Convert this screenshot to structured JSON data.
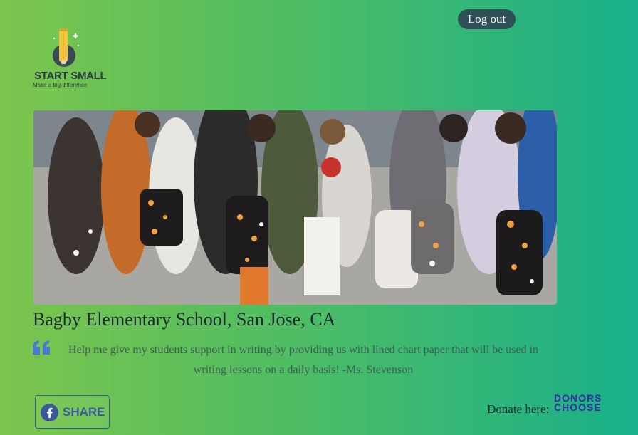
{
  "header": {
    "logout_label": "Log out"
  },
  "logo": {
    "title": "START SMALL",
    "tagline": "Make a big difference",
    "icon": "pencil-rocket-icon",
    "colors": {
      "pencil": "#f2c53d",
      "tip": "#2d3a44",
      "body": "#2d3a44"
    }
  },
  "project": {
    "photo_icon": "school-event-photo",
    "school": "Bagby Elementary School, San Jose, CA",
    "quote_icon": "quote-icon",
    "quote": "Help me give my students support in writing by providing us with lined chart paper that will be used in writing lessons on a daily basis! -Ms. Stevenson"
  },
  "footer": {
    "share_icon": "facebook-icon",
    "share_label": "SHARE",
    "donate_label": "Donate here:",
    "donors_line1": "DONORS",
    "donors_line2": "CHOOSE"
  },
  "colors": {
    "gradient_start": "#7cc54c",
    "gradient_end": "#19b08a",
    "logout_bg": "#2f4f57",
    "facebook_blue": "#3b5998",
    "quote_blue": "#4a7ad0",
    "donors_purple": "#3b2aa8"
  }
}
